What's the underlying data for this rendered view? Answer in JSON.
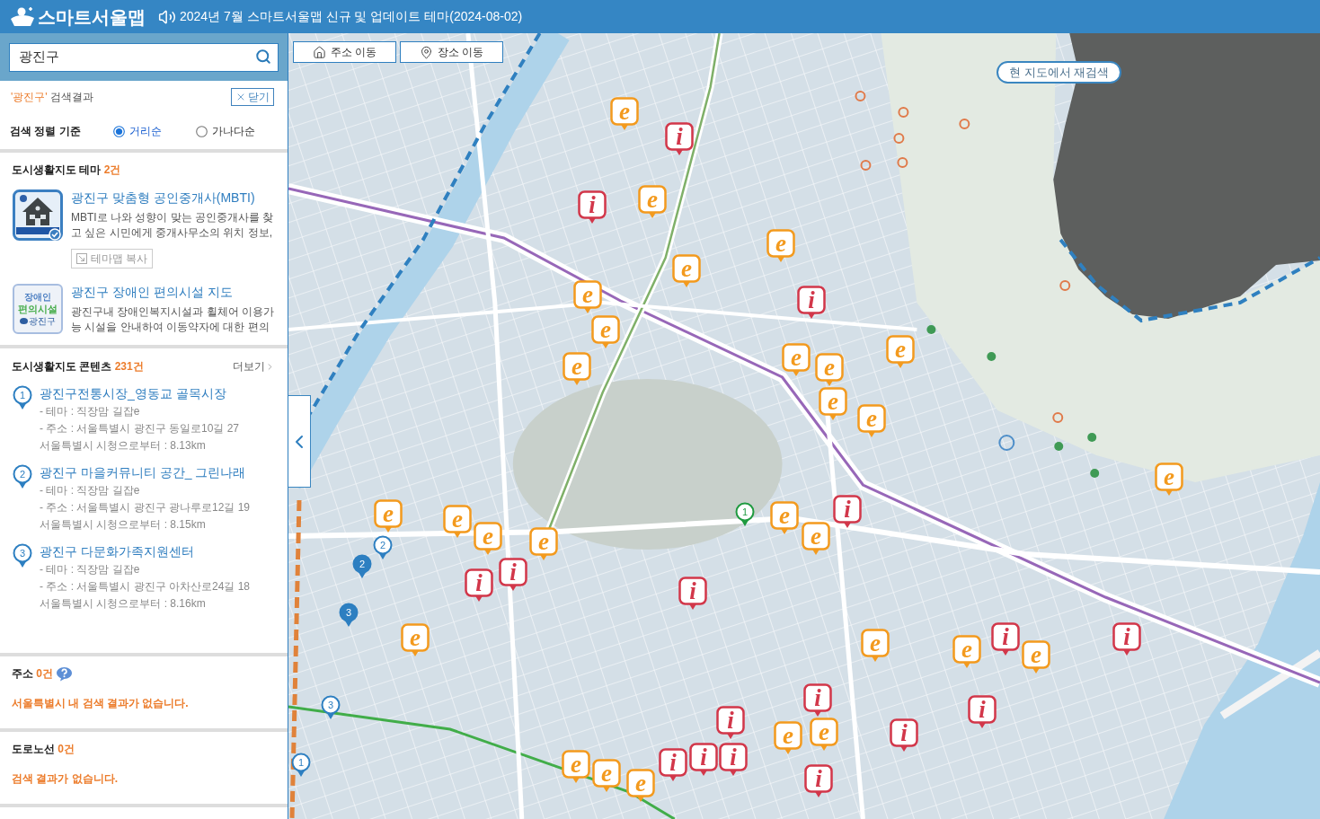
{
  "header": {
    "logo": "스마트서울맵",
    "notice": "2024년 7월 스마트서울맵 신규 및 업데이트 테마(2024-08-02)"
  },
  "search": {
    "value": "광진구"
  },
  "results": {
    "query": "'광진구'",
    "label": "검색결과",
    "close_button": "닫기"
  },
  "sort": {
    "label": "검색 정렬 기준",
    "options": [
      {
        "label": "거리순",
        "selected": true
      },
      {
        "label": "가나다순",
        "selected": false
      }
    ]
  },
  "theme_section": {
    "title": "도시생활지도 테마",
    "count": "2건",
    "items": [
      {
        "kind": "house",
        "title": "광진구 맞춤형 공인중개사(MBTI)",
        "description": "MBTI로 나와 성향이 맞는 공인중개사를 찾고 싶은 시민에게 중개사무소의 위치 정보,",
        "copy_button": "테마맵 복사"
      },
      {
        "kind": "accessibility",
        "thumbnail_text": [
          "장애인",
          "편의시설",
          "광진구"
        ],
        "title": "광진구 장애인 편의시설 지도",
        "description": "광진구내 장애인복지시설과 휠체어 이용가능 시설을 안내하여 이동약자에 대한 편의"
      }
    ]
  },
  "content_section": {
    "title": "도시생활지도 콘텐츠",
    "count": "231건",
    "more_link": "더보기",
    "items": [
      {
        "number": "1",
        "title": "광진구전통시장_영동교 골목시장",
        "lines": [
          "- 테마 : 직장맘 길잡e",
          "- 주소 : 서울특별시 광진구 동일로10길 27",
          "서울특별시 시청으로부터 : 8.13km"
        ]
      },
      {
        "number": "2",
        "title": "광진구 마을커뮤니티 공간_ 그린나래",
        "lines": [
          "- 테마 : 직장맘 길잡e",
          "- 주소 : 서울특별시 광진구 광나루로12길 19",
          "서울특별시 시청으로부터 : 8.15km"
        ]
      },
      {
        "number": "3",
        "title": "광진구 다문화가족지원센터",
        "lines": [
          "- 테마 : 직장맘 길잡e",
          "- 주소 : 서울특별시 광진구 아차산로24길 18",
          "서울특별시 시청으로부터 : 8.16km"
        ]
      }
    ]
  },
  "address_section": {
    "title": "주소",
    "count": "0건",
    "message": "서울특별시 내 검색 결과가 없습니다."
  },
  "road_section": {
    "title": "도로노선",
    "count": "0건",
    "message": "검색 결과가 없습니다."
  },
  "map": {
    "buttons": [
      {
        "kind": "home",
        "label": "주소 이동"
      },
      {
        "kind": "pin",
        "label": "장소 이동"
      }
    ],
    "research_button": "현 지도에서 재검색",
    "markers": [
      {
        "kind": "theme",
        "label": "e"
      },
      {
        "kind": "info",
        "label": "i"
      },
      {
        "kind": "info",
        "label": "i"
      },
      {
        "kind": "theme",
        "label": "e"
      },
      {
        "kind": "theme",
        "label": "e"
      },
      {
        "kind": "theme",
        "label": "e"
      },
      {
        "kind": "theme",
        "label": "e"
      },
      {
        "kind": "info",
        "label": "i"
      },
      {
        "kind": "theme",
        "label": "e"
      },
      {
        "kind": "theme",
        "label": "e"
      },
      {
        "kind": "theme",
        "label": "e"
      },
      {
        "kind": "theme",
        "label": "e"
      },
      {
        "kind": "theme",
        "label": "e"
      },
      {
        "kind": "theme",
        "label": "e"
      },
      {
        "kind": "theme",
        "label": "e"
      },
      {
        "kind": "theme",
        "label": "e"
      },
      {
        "kind": "theme",
        "label": "e"
      },
      {
        "kind": "theme",
        "label": "e"
      },
      {
        "kind": "theme",
        "label": "e"
      },
      {
        "kind": "theme",
        "label": "e"
      },
      {
        "kind": "theme",
        "label": "e"
      },
      {
        "kind": "theme",
        "label": "e"
      },
      {
        "kind": "info",
        "label": "i"
      },
      {
        "kind": "info",
        "label": "i"
      },
      {
        "kind": "info",
        "label": "i"
      },
      {
        "kind": "info",
        "label": "i"
      },
      {
        "kind": "theme",
        "label": "e"
      },
      {
        "kind": "theme",
        "label": "e"
      },
      {
        "kind": "theme",
        "label": "e"
      },
      {
        "kind": "info",
        "label": "i"
      },
      {
        "kind": "theme",
        "label": "e"
      },
      {
        "kind": "info",
        "label": "i"
      },
      {
        "kind": "info",
        "label": "i"
      },
      {
        "kind": "info",
        "label": "i"
      },
      {
        "kind": "info",
        "label": "i"
      },
      {
        "kind": "theme",
        "label": "e"
      },
      {
        "kind": "theme",
        "label": "e"
      },
      {
        "kind": "info",
        "label": "i"
      },
      {
        "kind": "theme",
        "label": "e"
      },
      {
        "kind": "theme",
        "label": "e"
      },
      {
        "kind": "theme",
        "label": "e"
      },
      {
        "kind": "info",
        "label": "i"
      },
      {
        "kind": "info",
        "label": "i"
      },
      {
        "kind": "info",
        "label": "i"
      },
      {
        "kind": "info",
        "label": "i"
      }
    ],
    "result_pins": [
      {
        "kind": "current",
        "label": "1"
      },
      {
        "kind": "outline",
        "label": "2"
      },
      {
        "kind": "solid",
        "label": "2"
      },
      {
        "kind": "solid",
        "label": "3"
      },
      {
        "kind": "outline",
        "label": "3"
      },
      {
        "kind": "outline",
        "label": "1"
      }
    ]
  }
}
